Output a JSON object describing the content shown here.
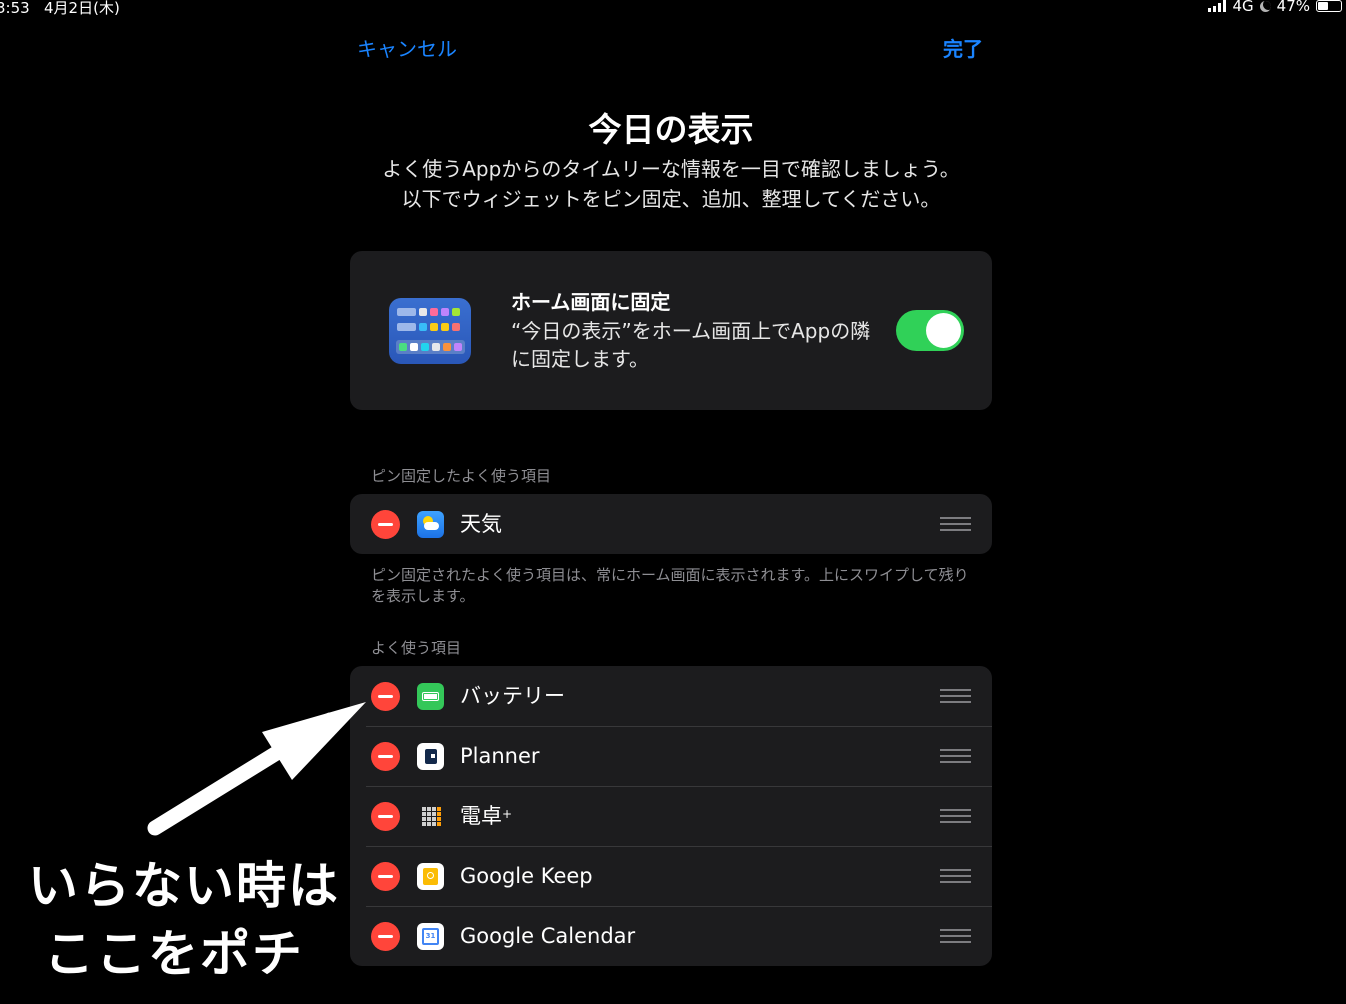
{
  "status_bar": {
    "time": "3:53",
    "date": "4月2日(木)",
    "network": "4G",
    "battery": "47%",
    "battery_level_percent": 47
  },
  "nav": {
    "cancel": "キャンセル",
    "done": "完了"
  },
  "title": "今日の表示",
  "description": "よく使うAppからのタイムリーな情報を一目で確認しましょう。以下でウィジェットをピン固定、追加、整理してください。",
  "pin_home": {
    "heading": "ホーム画面に固定",
    "body": "“今日の表示”をホーム画面上でAppの隣に固定します。",
    "toggle_on": true,
    "toggle_color": "#30d158"
  },
  "pinned_section": {
    "header": "ピン固定したよく使う項目",
    "items": [
      {
        "label": "天気",
        "icon": "weather-icon"
      }
    ],
    "footer": "ピン固定されたよく使う項目は、常にホーム画面に表示されます。上にスワイプして残りを表示します。"
  },
  "favorites_section": {
    "header": "よく使う項目",
    "items": [
      {
        "label": "バッテリー",
        "icon": "battery-icon"
      },
      {
        "label": "Planner",
        "icon": "planner-icon"
      },
      {
        "label": "電卓",
        "suffix": "+",
        "icon": "calculator-icon"
      },
      {
        "label": "Google Keep",
        "icon": "google-keep-icon"
      },
      {
        "label": "Google Calendar",
        "icon": "google-calendar-icon",
        "icon_text": "31"
      }
    ]
  },
  "annotation": {
    "line1": "いらない時は",
    "line2": "ここをポチ"
  },
  "colors": {
    "accent": "#1a84ff",
    "remove": "#ff453a",
    "card": "#1c1c1e"
  }
}
